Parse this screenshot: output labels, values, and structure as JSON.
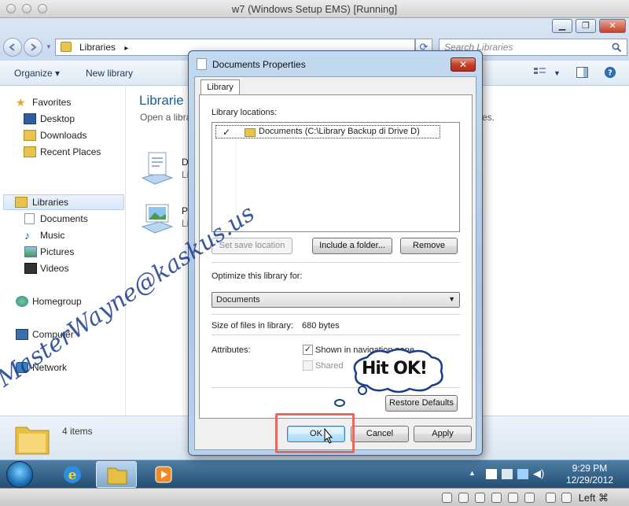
{
  "host": {
    "title": "w7 (Windows Setup EMS) [Running]",
    "status_label": "Left ⌘"
  },
  "explorer": {
    "address": "Libraries",
    "address_sep": "▸",
    "search_placeholder": "Search Libraries",
    "toolbar": {
      "organize": "Organize ▾",
      "new_library": "New library"
    },
    "window_controls": {
      "minimize": "▁",
      "maximize": "❐",
      "close": "✕"
    },
    "nav": {
      "favorites": "Favorites",
      "desktop": "Desktop",
      "downloads": "Downloads",
      "recent_places": "Recent Places",
      "libraries": "Libraries",
      "documents": "Documents",
      "music": "Music",
      "pictures": "Pictures",
      "videos": "Videos",
      "homegroup": "Homegroup",
      "computer": "Computer",
      "network": "Network"
    },
    "content": {
      "title": "Librarie",
      "subtitle": "Open a libra",
      "subtitle_tail": "es.",
      "items": [
        {
          "name": "D",
          "kind": "Li"
        },
        {
          "name": "P",
          "kind": "Li"
        }
      ]
    },
    "details": {
      "count": "4 items"
    }
  },
  "taskbar": {
    "time": "9:29 PM",
    "date": "12/29/2012"
  },
  "dialog": {
    "title": "Documents Properties",
    "close": "✕",
    "tab": "Library",
    "library_locations_label": "Library locations:",
    "locations": [
      {
        "checked": "✓",
        "label": "Documents (C:\\Library Backup di Drive D)"
      }
    ],
    "set_save_location": "Set save location",
    "include_folder": "Include a folder...",
    "remove": "Remove",
    "optimize_label": "Optimize this library for:",
    "optimize_value": "Documents",
    "size_label": "Size of files in library:",
    "size_value": "680 bytes",
    "attributes_label": "Attributes:",
    "attr_nav_pane": "Shown in navigation pane",
    "attr_nav_pane_checked": "✓",
    "attr_shared": "Shared",
    "restore_defaults": "Restore Defaults",
    "ok": "OK",
    "cancel": "Cancel",
    "apply": "Apply"
  },
  "overlay": {
    "callout": "Hit OK!",
    "watermark": "MasterWayne@kaskus.us"
  }
}
